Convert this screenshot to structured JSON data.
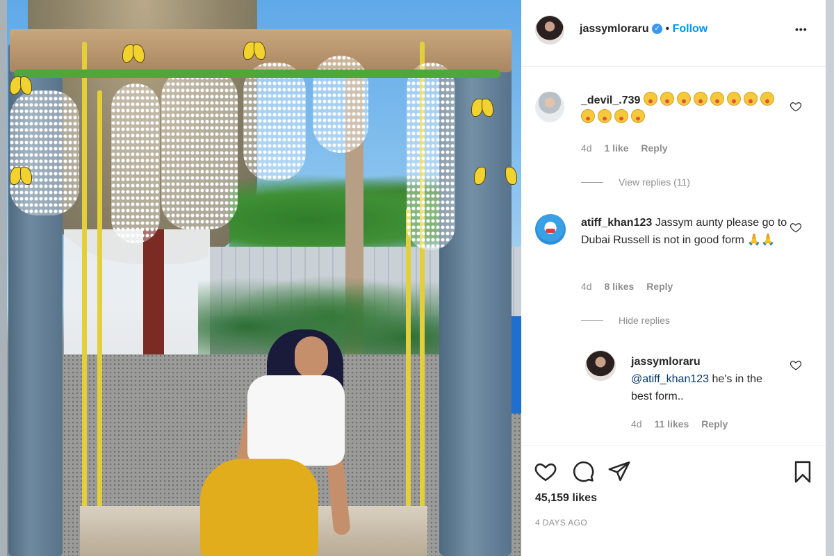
{
  "post": {
    "owner_username": "jassymloraru",
    "verified": true,
    "separator": "•",
    "follow_label": "Follow",
    "more_label": "•••"
  },
  "comments": [
    {
      "username": "_devil_.739",
      "emoji_count": 12,
      "emoji_name": "face-kiss-emoji",
      "age": "4d",
      "likes": "1 like",
      "reply_label": "Reply",
      "replies_toggle": "View replies (11)"
    },
    {
      "username": "atiff_khan123",
      "text": "Jassym aunty please go to Dubai Russell is not in good form 🙏🙏",
      "age": "4d",
      "likes": "8 likes",
      "reply_label": "Reply",
      "replies_toggle": "Hide replies",
      "reply": {
        "username": "jassymloraru",
        "mention": "@atiff_khan123",
        "text": " he's in the best form..",
        "age": "4d",
        "likes": "11 likes",
        "reply_label": "Reply"
      }
    }
  ],
  "actions": {
    "like_icon": "heart-icon",
    "comment_icon": "comment-icon",
    "share_icon": "send-icon",
    "save_icon": "bookmark-icon"
  },
  "stats": {
    "likes": "45,159 likes",
    "posted": "4 DAYS AGO"
  },
  "colors": {
    "link_blue": "#0095f6",
    "verified_blue": "#3897f0",
    "muted_text": "#8e8e8e",
    "text": "#262626"
  }
}
